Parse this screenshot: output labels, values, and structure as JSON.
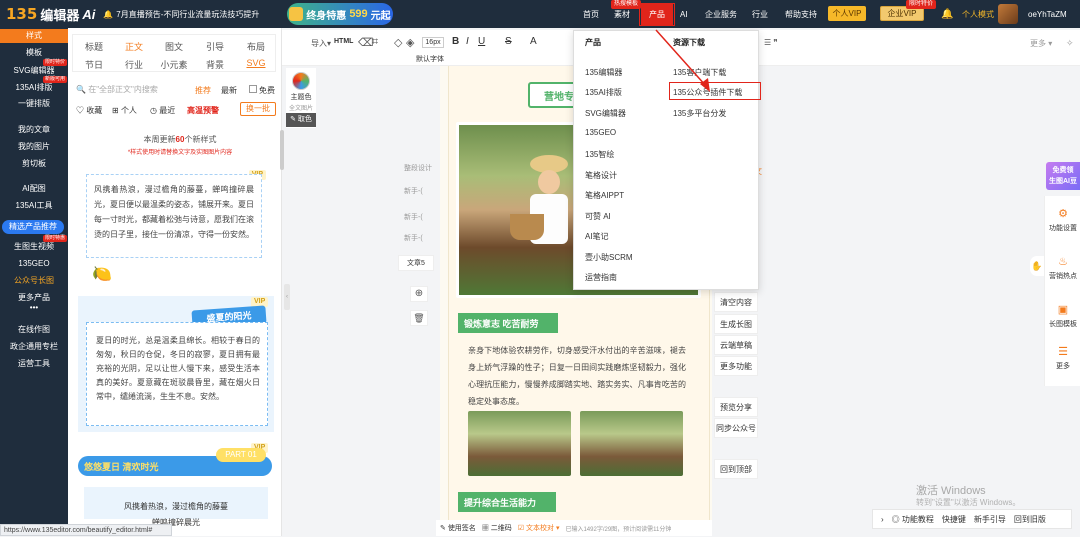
{
  "brand": {
    "logo_num": "135",
    "logo_text": "编辑器",
    "logo_ai": "Ai"
  },
  "announce": "7月直播预告-不同行业流量玩法技巧提升",
  "promo": {
    "text": "终身特惠",
    "price": "599",
    "unit": "元起"
  },
  "nav": {
    "home": "首页",
    "material": "素材",
    "product": "产品",
    "ai": "AI",
    "enterprise": "企业服务",
    "industry": "行业",
    "help": "帮助支持",
    "personal_vip": "个人VIP",
    "enterprise_vip": "企业VIP",
    "mode": "个人模式",
    "username": "oeYhTaZM",
    "hot_badge": "热搜模板",
    "vip_badge": "限时特价"
  },
  "sidebar": {
    "items": [
      "样式",
      "模板",
      "SVG编辑器",
      "135AI排版",
      "一键排版",
      "我的文章",
      "我的图片",
      "剪切板",
      "AI配图",
      "135AI工具",
      "精选产品推荐",
      "生图生视频",
      "135GEO",
      "公众号长图",
      "更多产品",
      "在线作图",
      "政企通用专栏",
      "运营工具"
    ],
    "tags": {
      "svg": "限时特价",
      "ai_layout": "新版可用",
      "video": "限时特惠"
    }
  },
  "panel": {
    "tabs_row1": [
      "标题",
      "正文",
      "图文",
      "引导",
      "布局"
    ],
    "tabs_row2": [
      "节日",
      "行业",
      "小元素",
      "背景",
      "SVG"
    ],
    "search_placeholder": "在\"全部正文\"内搜索",
    "recommend": "推荐",
    "latest": "最新",
    "free": "免费",
    "collect": "收藏",
    "personal": "个人",
    "recent": "最近",
    "fresh_hot": "高温预警",
    "next_batch": "换一批",
    "update_prefix": "本周更新",
    "update_count": "60",
    "update_suffix": "个新样式",
    "update_note": "*样式使用时请替换文字及实图图片内容",
    "card1": "风携着热浪，漫过檐角的藤蔓，蝉鸣撞碎晨光，夏日便以最温柔的姿态，铺展开来。夏日每一寸时光，都藏着松弛与诗意，愿我们在滚烫的日子里，接住一份清凉，守得一份安然。",
    "card2_title": "盛夏的阳光",
    "card2": "夏日的时光，总是温柔且绵长。相较于春日的匆匆，秋日的仓促，冬日的寂寥，夏日拥有最充裕的光阴，足以让世人慢下来，感受生活本真的美好。夏意藏在斑驳晨昏里，藏在烟火日常中，缱绻流淌，生生不息。安然。",
    "card3_title": "悠悠夏日 清欢时光",
    "card3_part": "PART 01",
    "card3_text": "风携着热浪，漫过檐角的藤蔓",
    "card3_text2": "蝉鸣撞碎晨光",
    "vip": "VIP"
  },
  "toolbar": {
    "import": "导入",
    "html": "HTML",
    "fontsize": "16px",
    "default_font": "默认字体",
    "more": "更多"
  },
  "editor": {
    "theme_color": "主题色",
    "full_doc_color": "全文图片",
    "pick_color": "取色",
    "heading": "营地专",
    "section1": "锻炼意志 吃苦耐劳",
    "para1": "亲身下地体验农耕劳作，切身感受汗水付出的辛苦滋味，褪去身上娇气浮躁的性子；日复一日田间实践磨炼坚韧毅力，强化心理抗压能力，慢慢养成脚踏实地、踏实务实、凡事肯吃苦的稳定处事态度。",
    "section2": "提升综合生活能力",
    "left_labels": [
      "整段设计",
      "新手-(",
      "新手-(",
      "新手-("
    ],
    "doc5": "文章5",
    "side_text": "文"
  },
  "side_buttons": [
    "清空内容",
    "生成长图",
    "云端草稿",
    "更多功能",
    "预览分享",
    "同步公众号",
    "回到顶部"
  ],
  "dropdown": {
    "col1_head": "产品",
    "col1": [
      "135编辑器",
      "135AI排版",
      "SVG编辑器",
      "135GEO",
      "135智绘",
      "笔格设计",
      "笔格AIPPT",
      "可赞 AI",
      "AI笔记",
      "壹小助SCRM",
      "运营指南"
    ],
    "col2_head": "资源下载",
    "col2": [
      "135客户端下载",
      "135公众号插件下载",
      "135多平台分发"
    ]
  },
  "right_rail": {
    "free_gen_line1": "免费领",
    "free_gen_line2": "生图AI豆",
    "items": [
      "功能设置",
      "营销热点",
      "长图模板",
      "更多"
    ]
  },
  "statusbar": {
    "sign": "使用签名",
    "qrcode": "二维码",
    "proof": "文本校对",
    "stats": "已输入1492字/29图，预计阅读需11分钟"
  },
  "bottombar": {
    "tutorial": "功能教程",
    "shortcut": "快捷键",
    "guide": "新手引导",
    "old": "回到旧版"
  },
  "watermark": {
    "line1": "激活 Windows",
    "line2": "转到\"设置\"以激活 Windows。"
  },
  "url": "https://www.135editor.com/beautify_editor.html#",
  "colors": {
    "topbar": "#1f2d3d",
    "accent": "#f37b1d",
    "red": "#e1251b",
    "green": "#52b36a"
  }
}
